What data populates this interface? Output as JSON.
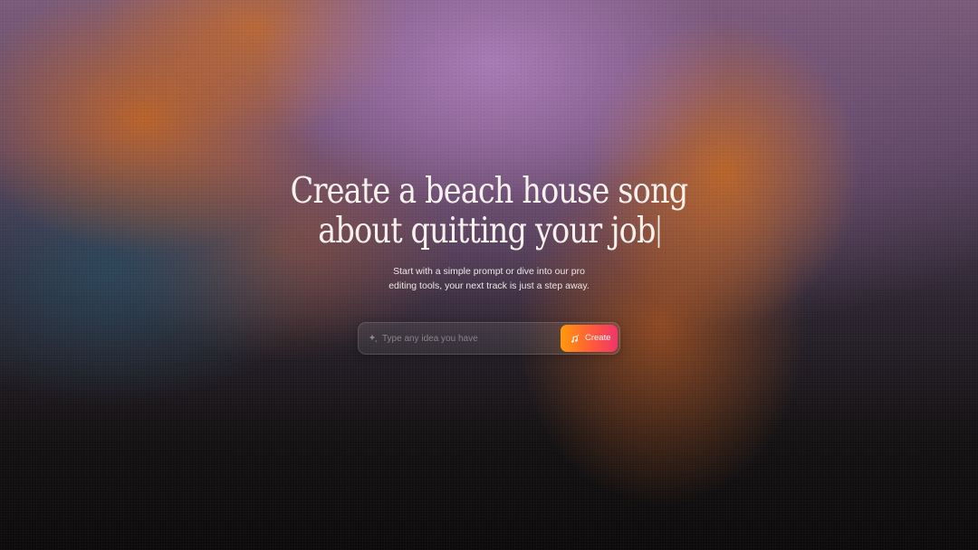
{
  "hero": {
    "headline_line1": "Create a beach house song",
    "headline_line2": "about quitting your job",
    "subtitle_line1": "Start with a simple prompt or dive into our pro",
    "subtitle_line2": "editing tools, your next track is just a step away."
  },
  "prompt": {
    "placeholder": "Type any idea you have",
    "value": "",
    "leading_icon": "sparkle-icon"
  },
  "create_button": {
    "label": "Create",
    "icon": "music-note-sparkle-icon",
    "gradient_colors": [
      "#ff9a0a",
      "#ff5a3a",
      "#f0346e"
    ]
  }
}
